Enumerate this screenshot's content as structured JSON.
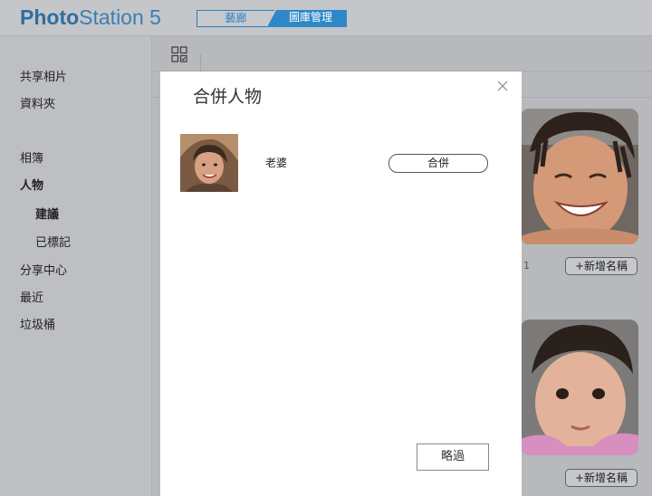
{
  "app": {
    "logo_bold": "Photo",
    "logo_light": "Station 5"
  },
  "mode_switch": {
    "gallery_label": "藝廊",
    "library_label": "圖庫管理"
  },
  "sidebar": {
    "items": [
      {
        "label": "共享相片"
      },
      {
        "label": "資料夾"
      },
      {
        "label": "相簿"
      },
      {
        "label": "人物"
      },
      {
        "label": "建議"
      },
      {
        "label": "已標記"
      },
      {
        "label": "分享中心"
      },
      {
        "label": "最近"
      },
      {
        "label": "垃圾桶"
      }
    ]
  },
  "toolbar": {
    "view_icon": "grid-view-icon"
  },
  "background": {
    "count_text": "1",
    "add_name_label_1": "+新增名稱",
    "add_name_label_2": "+新增名稱"
  },
  "modal": {
    "title": "合併人物",
    "close_icon": "close-icon",
    "person": {
      "name": "老婆"
    },
    "merge_label": "合併",
    "skip_label": "略過"
  },
  "colors": {
    "brand": "#2e6e9e",
    "accent": "#2e88c8"
  }
}
